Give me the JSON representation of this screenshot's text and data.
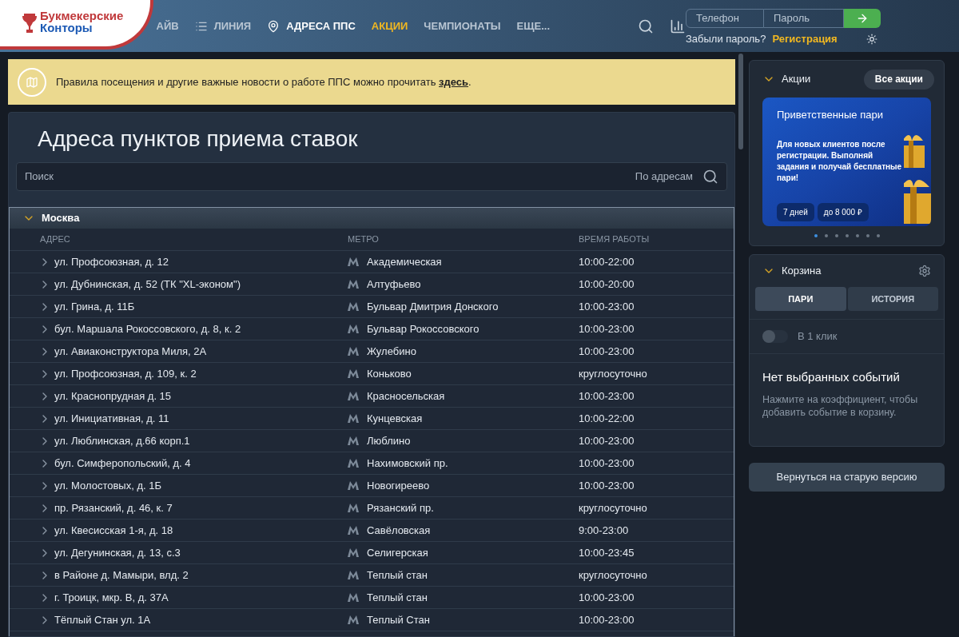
{
  "logo": {
    "line1": "Букмекерские",
    "line2": "Конторы"
  },
  "nav": [
    {
      "label": "АЙВ",
      "kind": "plain",
      "selected": false
    },
    {
      "label": "ЛИНИЯ",
      "kind": "list",
      "selected": false
    },
    {
      "label": "АДРЕСА ППС",
      "kind": "pin",
      "selected": true
    },
    {
      "label": "АКЦИИ",
      "kind": "promo",
      "selected": false
    },
    {
      "label": "ЧЕМПИОНАТЫ",
      "kind": "plain",
      "selected": false
    },
    {
      "label": "ЕЩЕ...",
      "kind": "plain",
      "selected": false
    }
  ],
  "login": {
    "phone_placeholder": "Телефон",
    "password_placeholder": "Пароль",
    "forgot": "Забыли пароль?",
    "register": "Регистрация"
  },
  "notice": {
    "text": "Правила посещения и другие важные новости о работе ППС можно прочитать ",
    "link": "здесь",
    "tail": "."
  },
  "page_title": "Адреса пунктов приема ставок",
  "search": {
    "placeholder": "Поиск",
    "scope": "По адресам"
  },
  "city": {
    "name": "Москва",
    "expanded": true
  },
  "table": {
    "columns": [
      "АДРЕС",
      "МЕТРО",
      "ВРЕМЯ РАБОТЫ"
    ],
    "rows": [
      [
        "ул. Профсоюзная, д. 12",
        "Академическая",
        "10:00-22:00"
      ],
      [
        "ул. Дубнинская, д. 52 (ТК \"XL-эконом\")",
        "Алтуфьево",
        "10:00-20:00"
      ],
      [
        "ул. Грина, д. 11Б",
        "Бульвар Дмитрия Донского",
        "10:00-23:00"
      ],
      [
        "бул. Маршала Рокоссовского, д. 8, к. 2",
        "Бульвар Рокоссовского",
        "10:00-23:00"
      ],
      [
        "ул. Авиаконструктора Миля, 2А",
        "Жулебино",
        "10:00-23:00"
      ],
      [
        "ул. Профсоюзная, д. 109, к. 2",
        "Коньково",
        "круглосуточно"
      ],
      [
        "ул. Краснопрудная д. 15",
        "Красносельская",
        "10:00-23:00"
      ],
      [
        "ул. Инициативная, д. 11",
        "Кунцевская",
        "10:00-22:00"
      ],
      [
        "ул. Люблинская, д.66 корп.1",
        "Люблино",
        "10:00-23:00"
      ],
      [
        "бул. Симферопольский, д. 4",
        "Нахимовский пр.",
        "10:00-23:00"
      ],
      [
        "ул. Молостовых, д. 1Б",
        "Новогиреево",
        "10:00-23:00"
      ],
      [
        "пр. Рязанский, д. 46, к. 7",
        "Рязанский пр.",
        "круглосуточно"
      ],
      [
        "ул. Квесисская 1-я, д. 18",
        "Савёловская",
        "9:00-23:00"
      ],
      [
        "ул. Дегунинская, д. 13, с.3",
        "Селигерская",
        "10:00-23:45"
      ],
      [
        "в Районе д. Мамыри, влд. 2",
        "Теплый стан",
        "круглосуточно"
      ],
      [
        "г. Троицк, мкр. В, д. 37А",
        "Теплый стан",
        "10:00-23:00"
      ],
      [
        "Тёплый Стан ул. 1А",
        "Теплый Стан",
        "10:00-23:00"
      ]
    ]
  },
  "promos": {
    "title": "Акции",
    "all_button": "Все акции",
    "expanded": true,
    "card": {
      "title": "Приветственные пари",
      "text": "Для новых клиентов после регистрации. Выполняй задания и получай бесплатные пари!",
      "tags": [
        "7 дней",
        "до 8 000 ₽"
      ]
    },
    "dots": [
      {
        "selected": true
      },
      {
        "selected": false
      },
      {
        "selected": false
      },
      {
        "selected": false
      },
      {
        "selected": false
      },
      {
        "selected": false
      },
      {
        "selected": false
      }
    ]
  },
  "basket": {
    "title": "Корзина",
    "expanded": true,
    "tabs": [
      {
        "label": "ПАРИ",
        "selected": true
      },
      {
        "label": "ИСТОРИЯ",
        "selected": false
      }
    ],
    "one_click": {
      "label": "В 1 клик",
      "on": false
    },
    "empty_title": "Нет выбранных событий",
    "empty_text": "Нажмите на коэффициент, чтобы добавить событие в корзину."
  },
  "old_version_button": "Вернуться на старую версию"
}
